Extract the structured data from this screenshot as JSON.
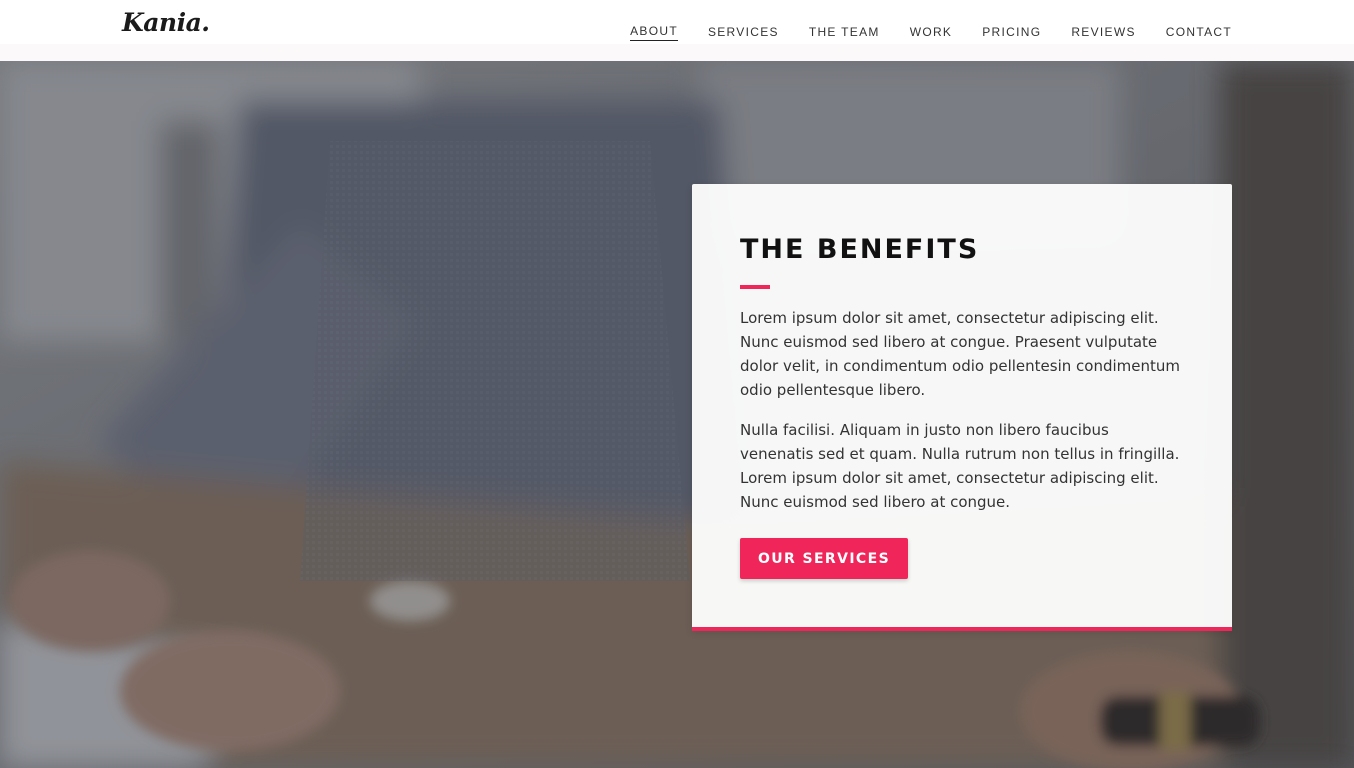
{
  "brand": {
    "logo_text": "Kania.",
    "accent_color": "#f0265a"
  },
  "nav": {
    "items": [
      {
        "label": "ABOUT",
        "active": true
      },
      {
        "label": "SERVICES",
        "active": false
      },
      {
        "label": "THE TEAM",
        "active": false
      },
      {
        "label": "WORK",
        "active": false
      },
      {
        "label": "PRICING",
        "active": false
      },
      {
        "label": "REVIEWS",
        "active": false
      },
      {
        "label": "CONTACT",
        "active": false
      }
    ]
  },
  "hero": {
    "background": "blurred-office-photo"
  },
  "card": {
    "title": "THE BENEFITS",
    "paragraph_1": "Lorem ipsum dolor sit amet, consectetur adipiscing elit. Nunc euismod sed libero at congue. Praesent vulputate dolor velit, in condimentum odio pellentesin condimentum odio pellentesque libero.",
    "paragraph_2": "Nulla facilisi. Aliquam in justo non libero faucibus venenatis sed et quam. Nulla rutrum non tellus in fringilla. Lorem ipsum dolor sit amet, consectetur adipiscing elit. Nunc euismod sed libero at congue.",
    "button_label": "OUR SERVICES"
  }
}
